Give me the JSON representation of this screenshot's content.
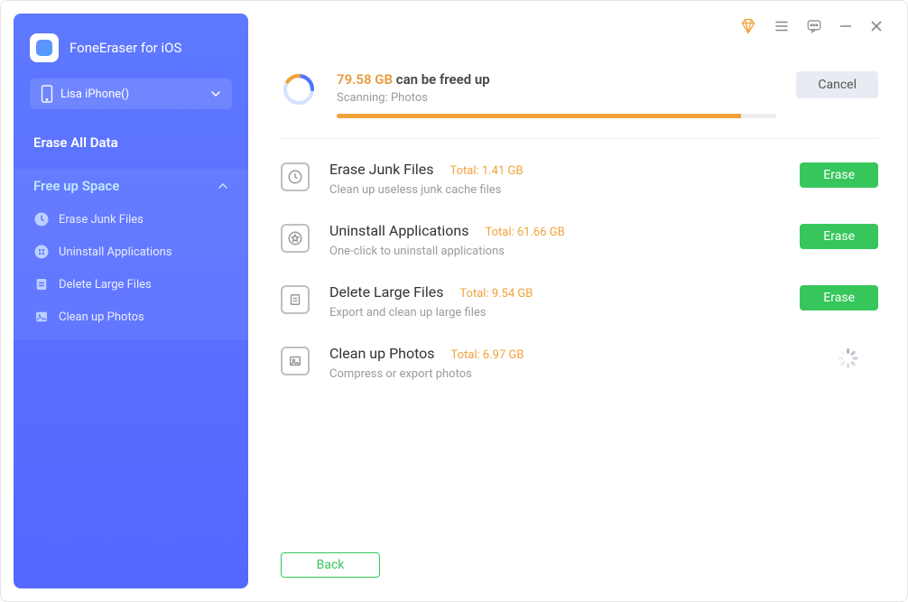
{
  "brand": {
    "title": "FoneEraser for iOS"
  },
  "device": {
    "name": "Lisa iPhone()"
  },
  "nav": {
    "erase_all": "Erase All Data",
    "free_up": "Free up Space",
    "items": [
      {
        "label": "Erase Junk Files"
      },
      {
        "label": "Uninstall Applications"
      },
      {
        "label": "Delete Large Files"
      },
      {
        "label": "Clean up Photos"
      }
    ]
  },
  "scan": {
    "freed_size": "79.58 GB",
    "freed_suffix": " can be freed up",
    "status": "Scanning: Photos",
    "progress_pct": 92
  },
  "buttons": {
    "cancel": "Cancel",
    "erase": "Erase",
    "back": "Back"
  },
  "list": [
    {
      "title": "Erase Junk Files",
      "total": "Total: 1.41 GB",
      "desc": "Clean up useless junk cache files",
      "action": "erase"
    },
    {
      "title": "Uninstall Applications",
      "total": "Total: 61.66 GB",
      "desc": "One-click to uninstall applications",
      "action": "erase"
    },
    {
      "title": "Delete Large Files",
      "total": "Total: 9.54 GB",
      "desc": "Export and clean up large files",
      "action": "erase"
    },
    {
      "title": "Clean up Photos",
      "total": "Total: 6.97 GB",
      "desc": "Compress or export photos",
      "action": "loading"
    }
  ]
}
